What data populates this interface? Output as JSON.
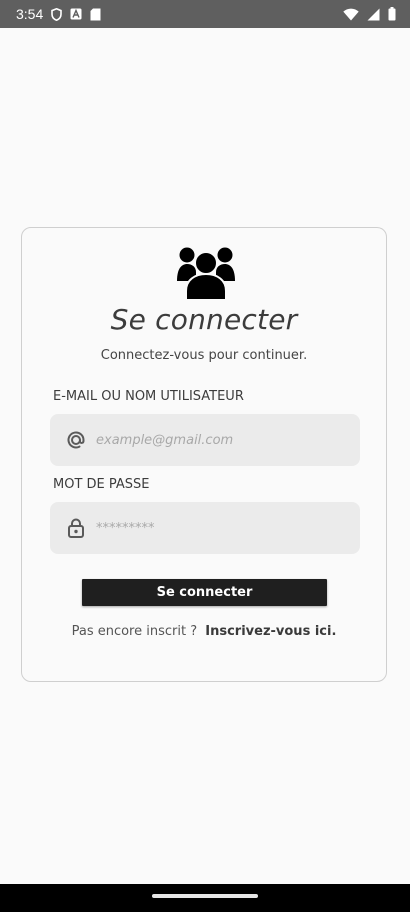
{
  "status_bar": {
    "time": "3:54",
    "left_icons": [
      "shield-icon",
      "a-badge-icon",
      "sd-card-icon"
    ],
    "right_icons": [
      "wifi-icon",
      "signal-icon",
      "battery-icon"
    ]
  },
  "login": {
    "icon": "users-group-icon",
    "title": "Se connecter",
    "subtitle": "Connectez-vous pour continuer.",
    "email": {
      "label": "E-MAIL OU NOM UTILISATEUR",
      "placeholder": "example@gmail.com",
      "value": "",
      "icon": "at-sign-icon"
    },
    "password": {
      "label": "MOT DE PASSE",
      "placeholder": "*********",
      "value": "",
      "icon": "lock-icon"
    },
    "submit_label": "Se connecter",
    "signup_prompt": "Pas encore inscrit ?",
    "signup_link": "Inscrivez-vous ici."
  },
  "colors": {
    "background": "#fafafa",
    "status_bar": "#5f5f5f",
    "button": "#1f1f1f",
    "field_bg": "#ebebeb"
  }
}
